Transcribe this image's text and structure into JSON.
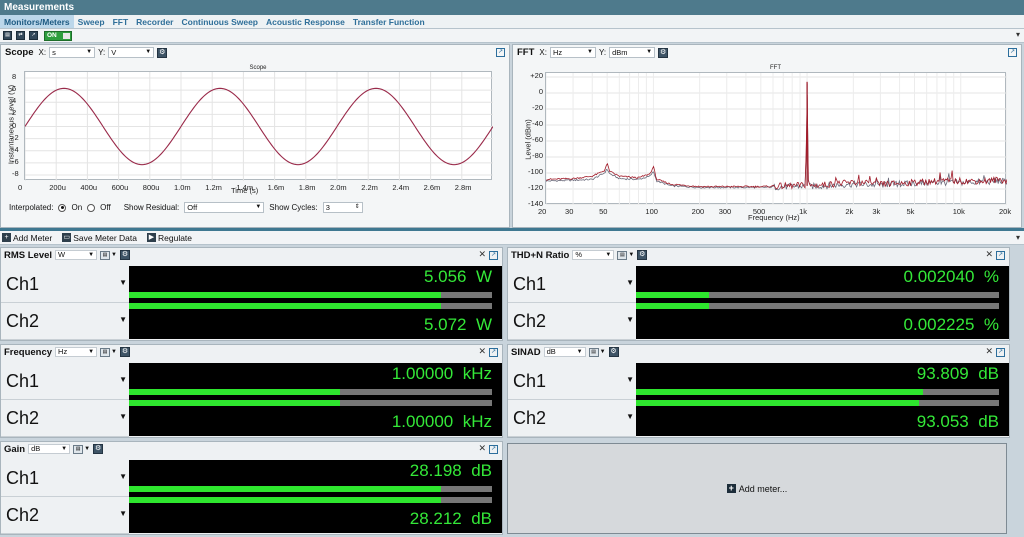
{
  "window": {
    "title": "Measurements"
  },
  "tabs": [
    "Monitors/Meters",
    "Sweep",
    "FFT",
    "Recorder",
    "Continuous Sweep",
    "Acoustic Response",
    "Transfer Function"
  ],
  "toolbar": {
    "on_label": "ON",
    "icons": [
      "monitor-icon",
      "sync-icon",
      "chart-icon"
    ]
  },
  "scope": {
    "title": "Scope",
    "x_label": "X:",
    "x_unit": "s",
    "y_label": "Y:",
    "y_unit": "V",
    "plot_title": "Scope",
    "interpolated_label": "Interpolated:",
    "on_label": "On",
    "off_label": "Off",
    "show_residual_label": "Show Residual:",
    "show_residual_value": "Off",
    "show_cycles_label": "Show Cycles:",
    "show_cycles_value": "3"
  },
  "fft": {
    "title": "FFT",
    "x_label": "X:",
    "x_unit": "Hz",
    "y_label": "Y:",
    "y_unit": "dBm",
    "plot_title": "FFT"
  },
  "meter_toolbar": {
    "add_meter": "Add Meter",
    "save_meter_data": "Save Meter Data",
    "regulate": "Regulate"
  },
  "meters": [
    {
      "name": "RMS Level",
      "unit": "W",
      "ch1": {
        "label": "Ch1",
        "value": "5.056",
        "unit": "W",
        "level": 0.86,
        "peak": 0.94
      },
      "ch2": {
        "label": "Ch2",
        "value": "5.072",
        "unit": "W",
        "level": 0.86,
        "peak": 0.94
      }
    },
    {
      "name": "THD+N Ratio",
      "unit": "%",
      "ch1": {
        "label": "Ch1",
        "value": "0.002040",
        "unit": "%",
        "level": 0.2,
        "peak": 0.22
      },
      "ch2": {
        "label": "Ch2",
        "value": "0.002225",
        "unit": "%",
        "level": 0.2,
        "peak": 0.22
      }
    },
    {
      "name": "Frequency",
      "unit": "Hz",
      "ch1": {
        "label": "Ch1",
        "value": "1.00000",
        "unit": "kHz",
        "level": 0.58,
        "peak": 0.97
      },
      "ch2": {
        "label": "Ch2",
        "value": "1.00000",
        "unit": "kHz",
        "level": 0.58,
        "peak": 0.97
      }
    },
    {
      "name": "SINAD",
      "unit": "dB",
      "ch1": {
        "label": "Ch1",
        "value": "93.809",
        "unit": "dB",
        "level": 0.79,
        "peak": 0.8
      },
      "ch2": {
        "label": "Ch2",
        "value": "93.053",
        "unit": "dB",
        "level": 0.78,
        "peak": 0.79
      }
    },
    {
      "name": "Gain",
      "unit": "dB",
      "ch1": {
        "label": "Ch1",
        "value": "28.198",
        "unit": "dB",
        "level": 0.86,
        "peak": 0.86
      },
      "ch2": {
        "label": "Ch2",
        "value": "28.212",
        "unit": "dB",
        "level": 0.86,
        "peak": 0.86
      }
    }
  ],
  "add_meter_placeholder": "Add meter...",
  "chart_data": [
    {
      "type": "line",
      "title": "Scope",
      "xlabel": "Time (s)",
      "ylabel": "Instantaneous Level (V)",
      "x_ticks": [
        "0",
        "200u",
        "400u",
        "600u",
        "800u",
        "1.0m",
        "1.2m",
        "1.4m",
        "1.6m",
        "1.8m",
        "2.0m",
        "2.2m",
        "2.4m",
        "2.6m",
        "2.8m"
      ],
      "y_ticks": [
        "8",
        "6",
        "4",
        "2",
        "0",
        "-2",
        "-4",
        "-6",
        "-8"
      ],
      "xlim": [
        0,
        0.003
      ],
      "ylim": [
        -9,
        9
      ],
      "grid": true,
      "series": [
        {
          "color": "#9a2a4a",
          "x": [
            0,
            0.00025,
            0.0005,
            0.00075,
            0.001,
            0.00125,
            0.0015,
            0.00175,
            0.002,
            0.00225,
            0.0025,
            0.00275,
            0.003
          ],
          "y": [
            0,
            6.3,
            0,
            -6.3,
            0,
            6.3,
            0,
            -6.3,
            0,
            6.3,
            0,
            -6.3,
            0
          ]
        }
      ]
    },
    {
      "type": "line",
      "title": "FFT",
      "xlabel": "Frequency (Hz)",
      "ylabel": "Level (dBm)",
      "x_ticks": [
        "20",
        "30",
        "50",
        "100",
        "200",
        "300",
        "500",
        "1k",
        "2k",
        "3k",
        "5k",
        "10k",
        "20k"
      ],
      "x_tick_values": [
        20,
        30,
        50,
        100,
        200,
        300,
        500,
        1000,
        2000,
        3000,
        5000,
        10000,
        20000
      ],
      "y_ticks": [
        "+20",
        "0",
        "-20",
        "-40",
        "-60",
        "-80",
        "-100",
        "-120",
        "-140"
      ],
      "y_tick_values": [
        20,
        0,
        -20,
        -40,
        -60,
        -80,
        -100,
        -120,
        -140
      ],
      "xscale": "log",
      "xlim": [
        20,
        20000
      ],
      "ylim": [
        -140,
        25
      ],
      "grid": true,
      "series": [
        {
          "color": "#a21c2a",
          "x": [
            20,
            30,
            40,
            48,
            50,
            52,
            60,
            80,
            95,
            100,
            105,
            130,
            200,
            300,
            500,
            800,
            980,
            1000,
            1020,
            2000,
            3000,
            5000,
            7000,
            10000,
            15000,
            18000,
            20000
          ],
          "y": [
            -108,
            -107,
            -104,
            -97,
            -88,
            -98,
            -104,
            -106,
            -101,
            -92,
            -108,
            -114,
            -117,
            -117,
            -117,
            -116,
            -115,
            14,
            -116,
            -112,
            -114,
            -112,
            -110,
            -110,
            -110,
            -108,
            -110
          ]
        },
        {
          "color": "#6a6a7a",
          "x": [
            20,
            30,
            40,
            48,
            50,
            52,
            60,
            80,
            95,
            100,
            105,
            130,
            200,
            300,
            500,
            800,
            980,
            1000,
            1020,
            2000,
            3000,
            5000,
            7000,
            10000,
            15000,
            18000,
            20000
          ],
          "y": [
            -110,
            -109,
            -108,
            -100,
            -95,
            -101,
            -107,
            -108,
            -104,
            -98,
            -110,
            -116,
            -118,
            -118,
            -118,
            -117,
            -116,
            12,
            -117,
            -114,
            -115,
            -113,
            -112,
            -112,
            -111,
            -110,
            -111
          ]
        }
      ]
    }
  ]
}
